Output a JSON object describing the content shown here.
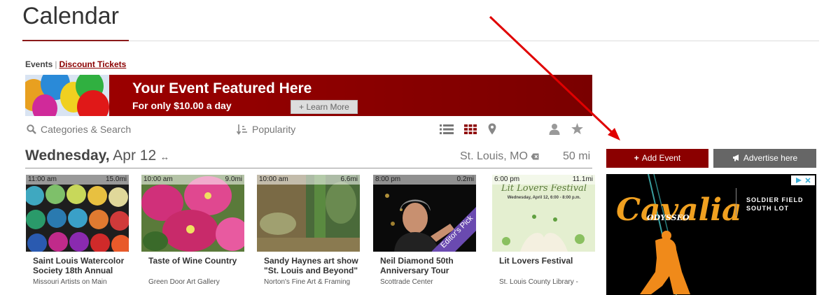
{
  "page": {
    "title": "Calendar"
  },
  "subnav": {
    "events": "Events",
    "separator": "|",
    "discount": "Discount Tickets"
  },
  "banner": {
    "title": "Your Event Featured Here",
    "subtitle": "For only $10.00 a day",
    "button": "+ Learn More"
  },
  "toolbar": {
    "categories": "Categories & Search",
    "sort": "Popularity",
    "active_view": "grid"
  },
  "date": {
    "weekday": "Wednesday,",
    "rest": " Apr 12",
    "arrows": "↔",
    "location": "St. Louis, MO",
    "distance": "50 mi"
  },
  "events": [
    {
      "time": "11:00 am",
      "dist": "15.0mi",
      "name": "Saint Louis Watercolor Society 18th Annual",
      "venue": "Missouri Artists on Main"
    },
    {
      "time": "10:00 am",
      "dist": "9.0mi",
      "name": "Taste of Wine Country",
      "venue": "Green Door Art Gallery"
    },
    {
      "time": "10:00 am",
      "dist": "6.6mi",
      "name": "Sandy Haynes art show \"St. Louis and Beyond\"",
      "venue": "Norton's Fine Art & Framing"
    },
    {
      "time": "8:00 pm",
      "dist": "0.2mi",
      "name": "Neil Diamond 50th Anniversary Tour",
      "venue": "Scottrade Center",
      "badge": "Editor's Pick"
    },
    {
      "time": "6:00 pm",
      "dist": "11.1mi",
      "name": "Lit Lovers Festival",
      "venue": "St. Louis County Library -",
      "poster_title": "Lit Lovers Festival",
      "poster_date": "Wednesday, April 12, 6:00 - 8:00 p.m."
    }
  ],
  "actions": {
    "add_event": "Add Event",
    "advertise": "Advertise here"
  },
  "ad": {
    "title": "Cavalia",
    "subtitle": "ODYSSEO",
    "location_line1": "SOLDIER FIELD",
    "location_line2": "SOUTH LOT"
  },
  "colors": {
    "brand": "#8b0000",
    "gray_button": "#666666",
    "annotation_arrow": "#e00000"
  }
}
